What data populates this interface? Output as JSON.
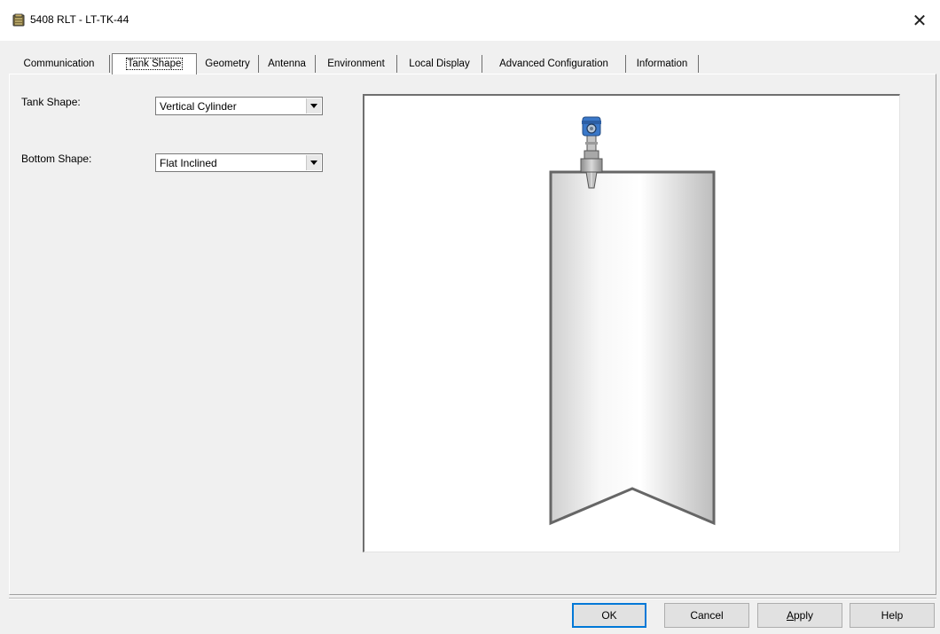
{
  "window": {
    "title": "5408 RLT  - LT-TK-44",
    "icons": {
      "app": "tank-app-icon",
      "close": "close-icon"
    },
    "close_glyph": "✕"
  },
  "tabs": [
    {
      "label": "Communication",
      "active": false
    },
    {
      "label": "Tank Shape",
      "active": true
    },
    {
      "label": "Geometry",
      "active": false
    },
    {
      "label": "Antenna",
      "active": false
    },
    {
      "label": "Environment",
      "active": false
    },
    {
      "label": "Local Display",
      "active": false
    },
    {
      "label": "Advanced Configuration",
      "active": false
    },
    {
      "label": "Information",
      "active": false
    }
  ],
  "form": {
    "tank_shape": {
      "label": "Tank Shape:",
      "value": "Vertical Cylinder"
    },
    "bottom_shape": {
      "label": "Bottom Shape:",
      "value": "Flat Inclined"
    }
  },
  "preview": {
    "colors": {
      "tank_outline": "#666666",
      "transmitter_head": "#3a78c9",
      "flange": "#9a9a9a"
    }
  },
  "buttons": {
    "ok": "OK",
    "cancel": "Cancel",
    "apply": "Apply",
    "help": "Help"
  }
}
